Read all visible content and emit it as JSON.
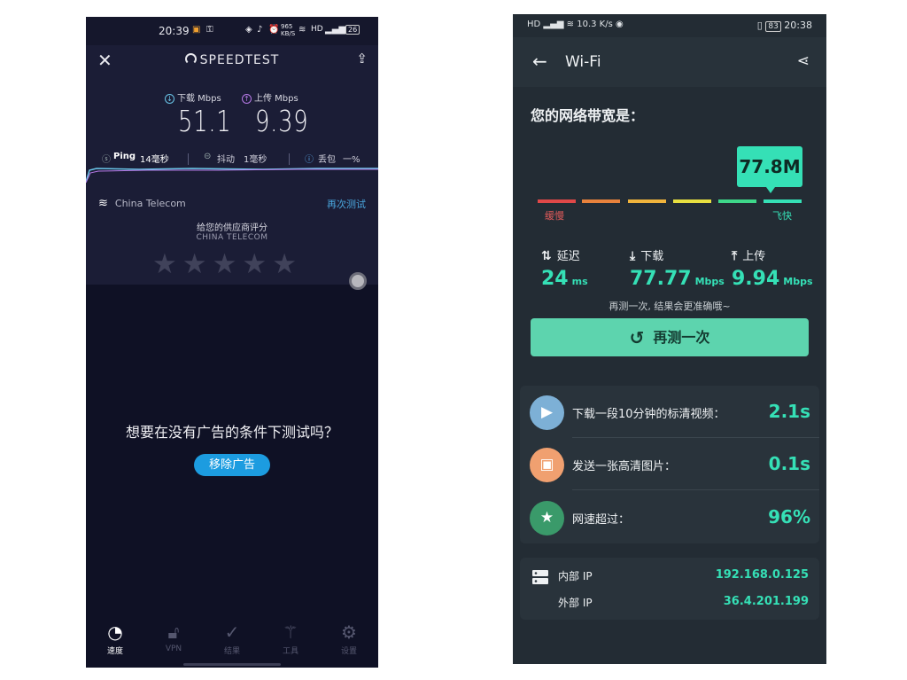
{
  "left": {
    "status": {
      "time": "20:39",
      "net_speed": "965 KB/S",
      "hd": "HD",
      "battery": "26"
    },
    "app_name": "SPEEDTEST",
    "download": {
      "label": "下载 Mbps",
      "value": "51.1"
    },
    "upload": {
      "label": "上传 Mbps",
      "value": "9.39"
    },
    "ping": {
      "label": "Ping",
      "value": "14毫秒"
    },
    "jitter": {
      "label": "抖动",
      "value": "1毫秒"
    },
    "loss": {
      "label": "丢包",
      "value": "一%"
    },
    "isp": "China Telecom",
    "retest": "再次测试",
    "rate_prompt": "给您的供应商评分",
    "rate_isp": "CHINA TELECOM",
    "rating_stars": 0,
    "ad_question": "想要在没有广告的条件下测试吗？",
    "remove_ads": "移除广告",
    "tabs": [
      {
        "label": "速度",
        "icon": "speed-icon"
      },
      {
        "label": "VPN",
        "icon": "lock-icon"
      },
      {
        "label": "结果",
        "icon": "check-icon"
      },
      {
        "label": "工具",
        "icon": "wand-icon"
      },
      {
        "label": "设置",
        "icon": "gear-icon"
      }
    ]
  },
  "right": {
    "status": {
      "net_speed": "10.3 K/s",
      "battery": "83",
      "time": "20:38"
    },
    "title": "Wi-Fi",
    "bandwidth_title": "您的网络带宽是：",
    "bandwidth_value": "77.8M",
    "scale": {
      "slow": "缓慢",
      "fast": "飞快",
      "colors": [
        "#e04848",
        "#e8823c",
        "#f0b43c",
        "#e8e040",
        "#3ed88a",
        "#35e0b6"
      ]
    },
    "latency": {
      "label": "延迟",
      "value": "24",
      "unit": "ms"
    },
    "download": {
      "label": "下载",
      "value": "77.77",
      "unit": "Mbps"
    },
    "upload": {
      "label": "上传",
      "value": "9.94",
      "unit": "Mbps"
    },
    "hint": "再测一次, 结果会更准确哦~",
    "retest": "再测一次",
    "perf": [
      {
        "label": "下载一段10分钟的标清视频：",
        "value": "2.1s",
        "icon": "video-icon",
        "color": "#7db0d6"
      },
      {
        "label": "发送一张高清图片：",
        "value": "0.1s",
        "icon": "image-icon",
        "color": "#f0a070"
      },
      {
        "label": "网速超过：",
        "value": "96%",
        "icon": "medal-icon",
        "color": "#3a9a6a"
      }
    ],
    "ip": {
      "internal_label": "内部 IP",
      "internal_value": "192.168.0.125",
      "external_label": "外部 IP",
      "external_value": "36.4.201.199"
    }
  }
}
